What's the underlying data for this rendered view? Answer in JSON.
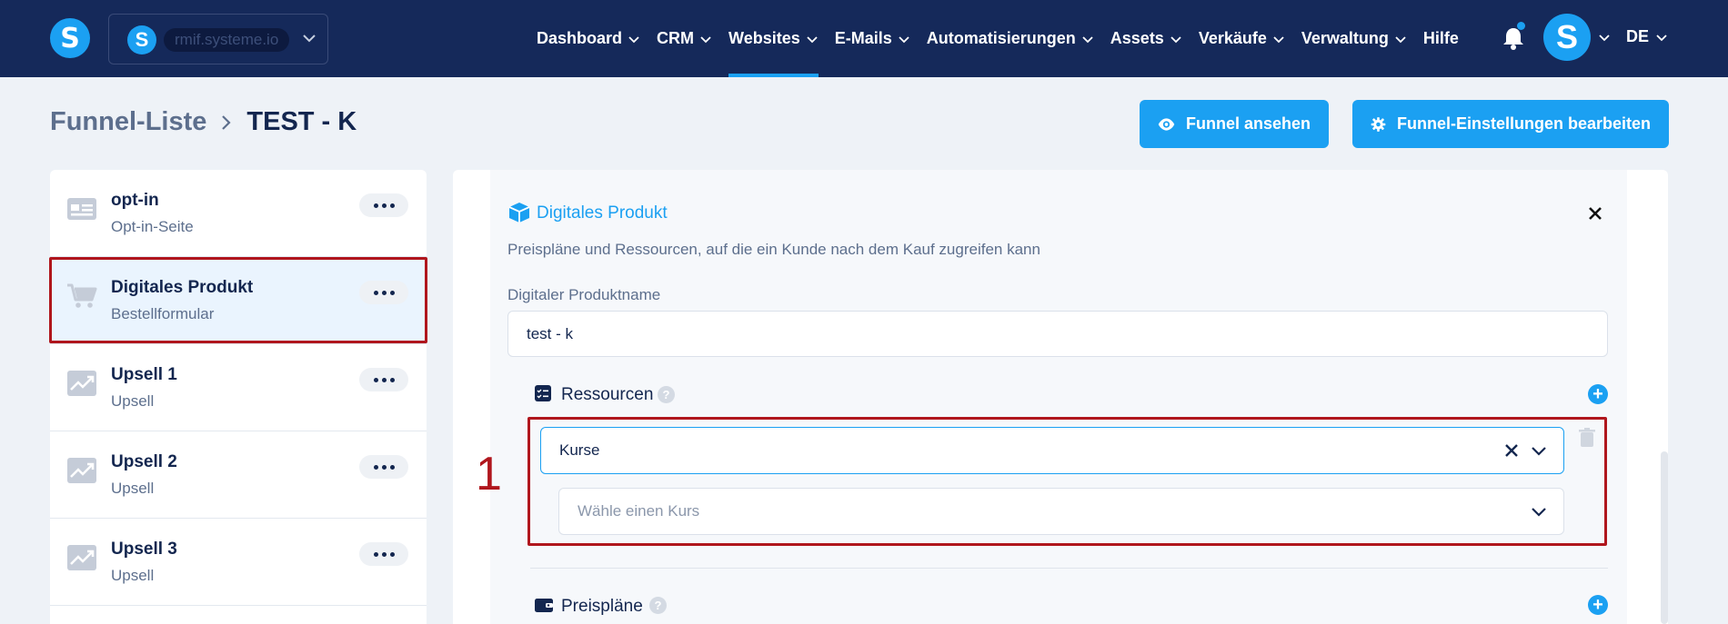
{
  "header": {
    "site_name": "rmif.systeme.io",
    "nav": [
      "Dashboard",
      "CRM",
      "Websites",
      "E-Mails",
      "Automatisierungen",
      "Assets",
      "Verkäufe",
      "Verwaltung",
      "Hilfe"
    ],
    "active_nav": "Websites",
    "language": "DE"
  },
  "breadcrumb": {
    "root": "Funnel-Liste",
    "current": "TEST - K"
  },
  "actions": {
    "view_funnel": "Funnel ansehen",
    "edit_settings": "Funnel-Einstellungen bearbeiten"
  },
  "steps": [
    {
      "title": "opt-in",
      "subtitle": "Opt-in-Seite",
      "icon": "optin-page-icon"
    },
    {
      "title": "Digitales Produkt",
      "subtitle": "Bestellformular",
      "icon": "cart-icon",
      "selected": true
    },
    {
      "title": "Upsell 1",
      "subtitle": "Upsell",
      "icon": "upsell-chart-icon"
    },
    {
      "title": "Upsell 2",
      "subtitle": "Upsell",
      "icon": "upsell-chart-icon"
    },
    {
      "title": "Upsell 3",
      "subtitle": "Upsell",
      "icon": "upsell-chart-icon"
    }
  ],
  "panel": {
    "title": "Digitales Produkt",
    "description": "Preispläne und Ressourcen, auf die ein Kunde nach dem Kauf zugreifen kann",
    "name_label": "Digitaler Produktname",
    "name_value": "test - k",
    "resources_label": "Ressourcen",
    "resource_type": "Kurse",
    "course_placeholder": "Wähle einen Kurs",
    "pricing_label": "Preispläne",
    "help_glyph": "?",
    "plus_glyph": "+"
  },
  "annotation": {
    "step_number": "1",
    "color": "#b0161d"
  },
  "colors": {
    "nav_bg": "#15295a",
    "accent": "#1ba0f2",
    "text_dark": "#13264f"
  }
}
